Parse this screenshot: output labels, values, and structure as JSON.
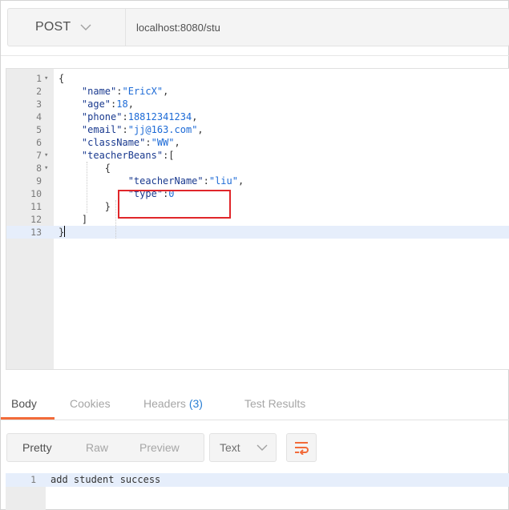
{
  "request": {
    "method": "POST",
    "url": "localhost:8080/stu"
  },
  "editor": {
    "lines": [
      {
        "num": "1",
        "fold": "▾",
        "html": "<span class=\"p\">{</span>"
      },
      {
        "num": "2",
        "fold": "",
        "html": "    <span class=\"k\">\"name\"</span><span class=\"p\">:</span><span class=\"s\">\"EricX\"</span><span class=\"p\">,</span>"
      },
      {
        "num": "3",
        "fold": "",
        "html": "    <span class=\"k\">\"age\"</span><span class=\"p\">:</span><span class=\"n\">18</span><span class=\"p\">,</span>"
      },
      {
        "num": "4",
        "fold": "",
        "html": "    <span class=\"k\">\"phone\"</span><span class=\"p\">:</span><span class=\"n\">18812341234</span><span class=\"p\">,</span>"
      },
      {
        "num": "5",
        "fold": "",
        "html": "    <span class=\"k\">\"email\"</span><span class=\"p\">:</span><span class=\"s\">\"jj@163.com\"</span><span class=\"p\">,</span>"
      },
      {
        "num": "6",
        "fold": "",
        "html": "    <span class=\"k\">\"className\"</span><span class=\"p\">:</span><span class=\"s\">\"WW\"</span><span class=\"p\">,</span>"
      },
      {
        "num": "7",
        "fold": "▾",
        "html": "    <span class=\"k\">\"teacherBeans\"</span><span class=\"p\">:[</span>"
      },
      {
        "num": "8",
        "fold": "▾",
        "html": "        <span class=\"p\">{</span>"
      },
      {
        "num": "9",
        "fold": "",
        "html": "            <span class=\"k\">\"teacherName\"</span><span class=\"p\">:</span><span class=\"s\">\"liu\"</span><span class=\"p\">,</span>"
      },
      {
        "num": "10",
        "fold": "",
        "html": "            <span class=\"k\">\"type\"</span><span class=\"p\">:</span><span class=\"n\">0</span>"
      },
      {
        "num": "11",
        "fold": "",
        "html": "        <span class=\"p\">}</span>"
      },
      {
        "num": "12",
        "fold": "",
        "html": "    <span class=\"p\">]</span>"
      },
      {
        "num": "13",
        "fold": "",
        "html": "<span class=\"p\">}</span><span class=\"cursor\"></span>"
      }
    ],
    "active_line": 13
  },
  "response_tabs": [
    {
      "label": "Body",
      "count": "",
      "active": true
    },
    {
      "label": "Cookies",
      "count": "",
      "active": false
    },
    {
      "label": "Headers",
      "count": "(3)",
      "active": false
    },
    {
      "label": "Test Results",
      "count": "",
      "active": false
    }
  ],
  "format": {
    "buttons": [
      {
        "label": "Pretty",
        "active": true
      },
      {
        "label": "Raw",
        "active": false
      },
      {
        "label": "Preview",
        "active": false
      }
    ],
    "type_select": "Text"
  },
  "response": {
    "line_number": "1",
    "text": "add student success"
  },
  "colors": {
    "accent": "#f26b3a",
    "highlight_box": "#e0262a",
    "count": "#2a7fd4"
  }
}
